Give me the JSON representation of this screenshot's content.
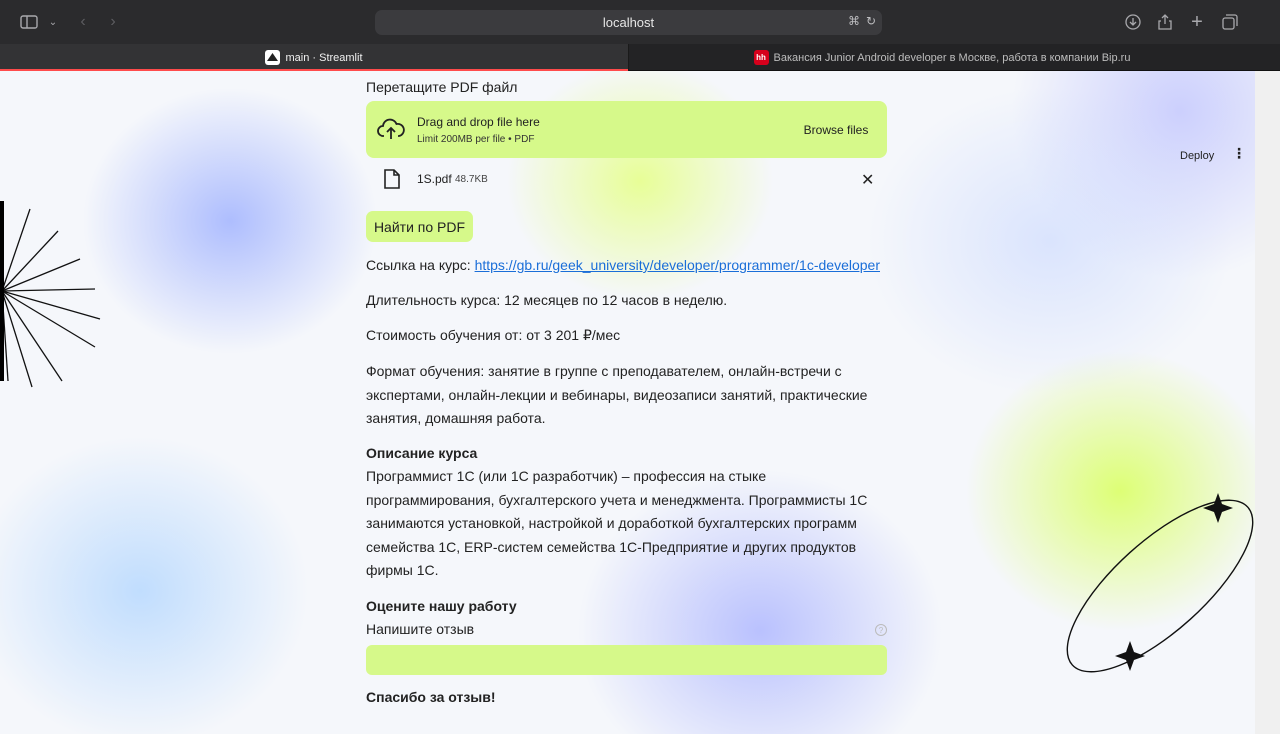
{
  "browser": {
    "url": "localhost",
    "tabs": [
      {
        "label": "main · Streamlit",
        "favicon": "streamlit-icon",
        "active": true
      },
      {
        "label": "Вакансия Junior Android developer в Москве, работа в компании Bip.ru",
        "favicon": "hh-icon",
        "favicon_text": "hh",
        "active": false
      }
    ]
  },
  "header": {
    "deploy_label": "Deploy"
  },
  "uploader": {
    "label": "Перетащите PDF файл",
    "drop_title": "Drag and drop file here",
    "drop_subtitle": "Limit 200MB per file • PDF",
    "browse_label": "Browse files",
    "file": {
      "name": "1S.pdf",
      "size": "48.7KB"
    }
  },
  "search_button": "Найти по PDF",
  "course": {
    "link_label": "Ссылка на курс:",
    "link_url": "https://gb.ru/geek_university/developer/programmer/1c-developer",
    "duration": "Длительность курса: 12 месяцев по 12 часов в неделю.",
    "price": "Стоимость обучения от: от 3 201 ₽/мес",
    "format": "Формат обучения: занятие в группе с преподавателем, онлайн-встречи с экспертами, онлайн-лекции и вебинары, видеозаписи занятий, практические занятия, домашняя работа.",
    "description_title": "Описание курса",
    "description": "Программист 1С (или 1С разработчик) – профессия на стыке программирования, бухгалтерского учета и менеджмента. Программисты 1С занимаются установкой, настройкой и доработкой бухгалтерских программ семейства 1С, ERP-систем семейства 1С-Предприятие и других продуктов фирмы 1С."
  },
  "feedback": {
    "title": "Оцените нашу работу",
    "input_label": "Напишите отзыв",
    "input_value": "",
    "thanks": "Спасибо за отзыв!"
  },
  "colors": {
    "accent_green": "#d6f98a",
    "link": "#1a6ed8",
    "tab_accent": "#ff4b4b"
  }
}
